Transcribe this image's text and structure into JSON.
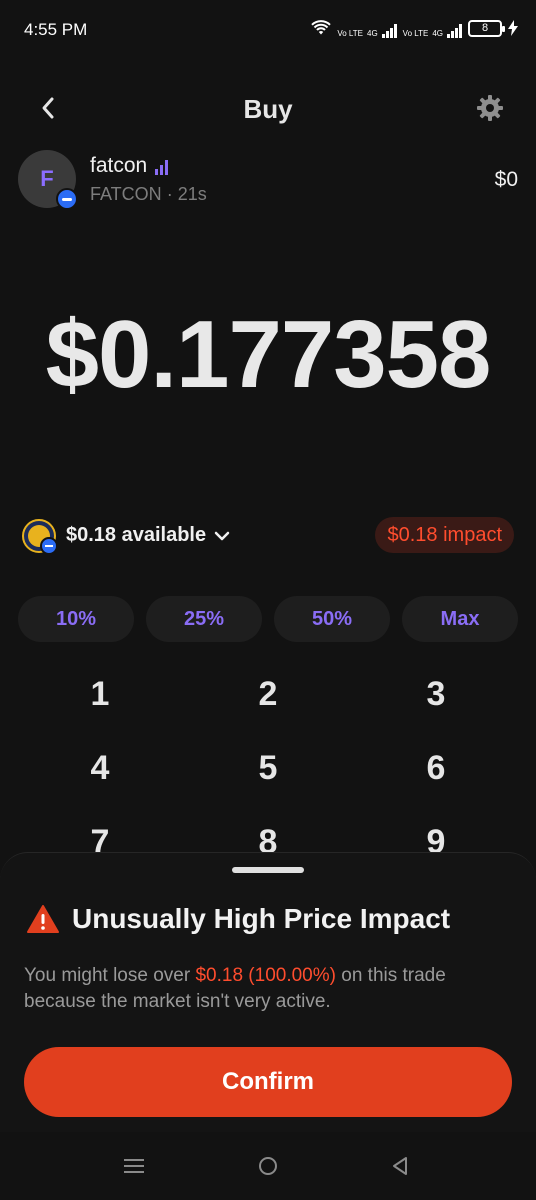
{
  "status": {
    "time": "4:55 PM",
    "net1": "Vo LTE",
    "net1_type": "4G",
    "net2": "Vo LTE",
    "net2_type": "4G",
    "battery": "8"
  },
  "header": {
    "title": "Buy"
  },
  "token": {
    "avatar_letter": "F",
    "name": "fatcon",
    "symbol": "FATCON",
    "age": "21s",
    "balance": "$0"
  },
  "amount": "$0.177358",
  "balance_row": {
    "available": "$0.18 available",
    "impact": "$0.18 impact"
  },
  "percent_buttons": [
    "10%",
    "25%",
    "50%",
    "Max"
  ],
  "keypad": [
    "1",
    "2",
    "3",
    "4",
    "5",
    "6",
    "7",
    "8",
    "9"
  ],
  "sheet": {
    "title": "Unusually High Price Impact",
    "body_prefix": "You might lose over ",
    "body_highlight": "$0.18 (100.00%)",
    "body_suffix": " on this trade because the market isn't very active.",
    "confirm_label": "Confirm"
  },
  "colors": {
    "background": "#121212",
    "accent_purple": "#8a6df5",
    "warning_red": "#e13f1e",
    "impact_text": "#ff4d2e"
  },
  "icons": {
    "back": "chevron-left-icon",
    "settings": "gear-icon",
    "signal": "signal-bars-icon",
    "warning": "warning-triangle-icon",
    "dropdown": "chevron-down-icon"
  }
}
